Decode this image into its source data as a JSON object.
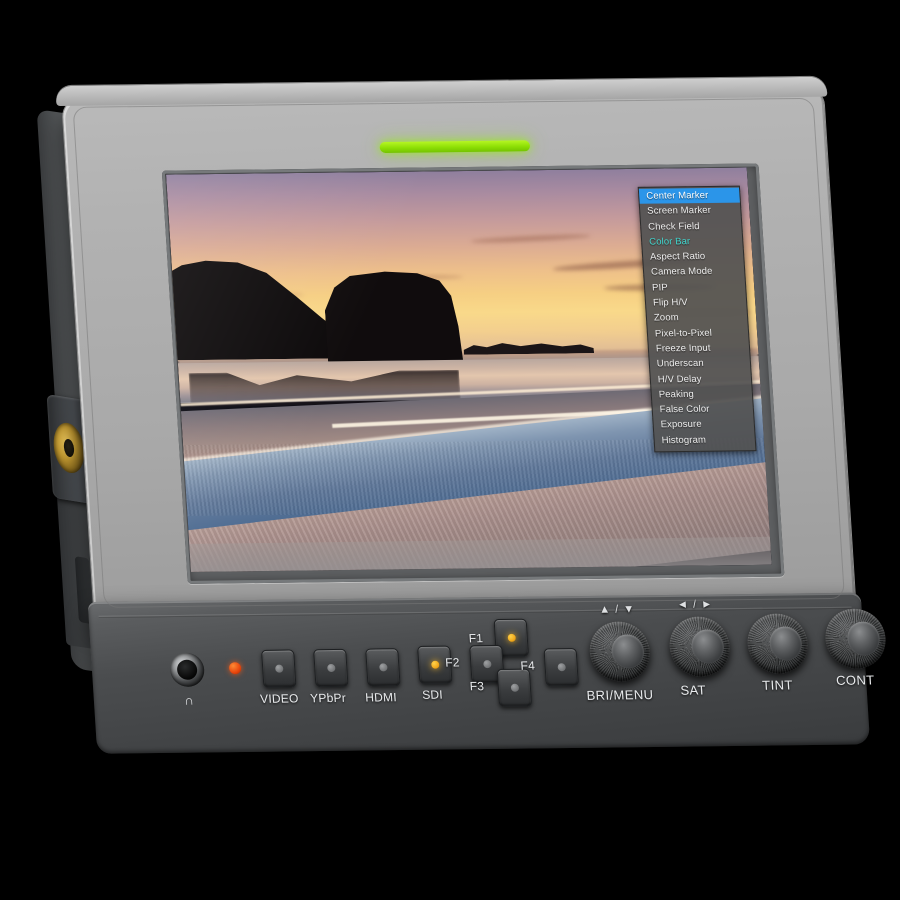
{
  "device": {
    "type": "7-inch on-camera field monitor",
    "status_led_color": "#8ddf05",
    "power_led_color": "#e8450c",
    "bezel_color": "#ababab",
    "panel_color": "#46484a"
  },
  "osd_menu": {
    "highlight_color": "#2b95e9",
    "alt_text_color": "#40d8d0",
    "items": [
      {
        "label": "Center Marker",
        "state": "selected"
      },
      {
        "label": "Screen Marker",
        "state": "normal"
      },
      {
        "label": "Check Field",
        "state": "normal"
      },
      {
        "label": "Color Bar",
        "state": "active"
      },
      {
        "label": "Aspect Ratio",
        "state": "normal"
      },
      {
        "label": "Camera Mode",
        "state": "normal"
      },
      {
        "label": "PIP",
        "state": "normal"
      },
      {
        "label": "Flip H/V",
        "state": "normal"
      },
      {
        "label": "Zoom",
        "state": "normal"
      },
      {
        "label": "Pixel-to-Pixel",
        "state": "normal"
      },
      {
        "label": "Freeze Input",
        "state": "normal"
      },
      {
        "label": "Underscan",
        "state": "normal"
      },
      {
        "label": "H/V Delay",
        "state": "normal"
      },
      {
        "label": "Peaking",
        "state": "normal"
      },
      {
        "label": "False Color",
        "state": "normal"
      },
      {
        "label": "Exposure",
        "state": "normal"
      },
      {
        "label": "Histogram",
        "state": "normal"
      }
    ]
  },
  "screen_image": {
    "subject": "beach sunset with rock silhouettes and wet sand reflections"
  },
  "controls": {
    "headphone_label": "∩",
    "source_buttons": [
      {
        "label": "VIDEO",
        "led": "off"
      },
      {
        "label": "YPbPr",
        "led": "off"
      },
      {
        "label": "HDMI",
        "led": "off"
      },
      {
        "label": "SDI",
        "led": "on"
      }
    ],
    "function_buttons": [
      {
        "label": "F1",
        "led": "on"
      },
      {
        "label": "F2",
        "led": "off"
      },
      {
        "label": "F3",
        "led": "off"
      },
      {
        "label": "F4",
        "led": "off"
      }
    ],
    "knobs": [
      {
        "label": "BRI/MENU",
        "arrows": "▲ / ▼"
      },
      {
        "label": "SAT",
        "arrows": "◄ / ►"
      },
      {
        "label": "TINT",
        "arrows": ""
      },
      {
        "label": "CONT",
        "arrows": ""
      }
    ]
  }
}
